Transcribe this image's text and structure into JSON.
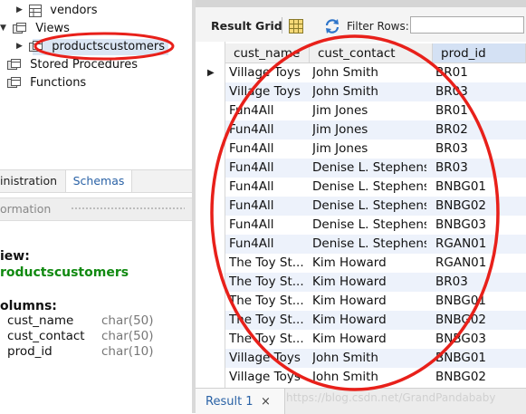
{
  "navigator": {
    "tree": [
      {
        "label": "vendors",
        "icon": "table-icon",
        "expander": "▶"
      },
      {
        "label": "Views",
        "icon": "views-folder-icon",
        "expander": "▼"
      },
      {
        "label": "productscustomers",
        "icon": "view-icon",
        "expander": "▶"
      },
      {
        "label": "Stored Procedures",
        "icon": "folder-icon",
        "expander": ""
      },
      {
        "label": "Functions",
        "icon": "folder-icon",
        "expander": ""
      }
    ],
    "tabs": {
      "administration": "inistration",
      "schemas": "Schemas"
    },
    "info_header": "ormation",
    "info": {
      "kind": "iew:",
      "name": "roductscustomers",
      "columns_label": "olumns:",
      "columns": [
        {
          "name": "cust_name",
          "type": "char(50)"
        },
        {
          "name": "cust_contact",
          "type": "char(50)"
        },
        {
          "name": "prod_id",
          "type": "char(10)"
        }
      ]
    }
  },
  "toolbar": {
    "result_grid_label": "Result Grid",
    "filter_label": "Filter Rows:",
    "filter_value": ""
  },
  "grid": {
    "columns": [
      "cust_name",
      "cust_contact",
      "prod_id"
    ],
    "rows": [
      [
        "Village Toys",
        "John Smith",
        "BR01"
      ],
      [
        "Village Toys",
        "John Smith",
        "BR03"
      ],
      [
        "Fun4All",
        "Jim Jones",
        "BR01"
      ],
      [
        "Fun4All",
        "Jim Jones",
        "BR02"
      ],
      [
        "Fun4All",
        "Jim Jones",
        "BR03"
      ],
      [
        "Fun4All",
        "Denise L. Stephens",
        "BR03"
      ],
      [
        "Fun4All",
        "Denise L. Stephens",
        "BNBG01"
      ],
      [
        "Fun4All",
        "Denise L. Stephens",
        "BNBG02"
      ],
      [
        "Fun4All",
        "Denise L. Stephens",
        "BNBG03"
      ],
      [
        "Fun4All",
        "Denise L. Stephens",
        "RGAN01"
      ],
      [
        "The Toy St...",
        "Kim Howard",
        "RGAN01"
      ],
      [
        "The Toy St...",
        "Kim Howard",
        "BR03"
      ],
      [
        "The Toy St...",
        "Kim Howard",
        "BNBG01"
      ],
      [
        "The Toy St...",
        "Kim Howard",
        "BNBG02"
      ],
      [
        "The Toy St...",
        "Kim Howard",
        "BNBG03"
      ],
      [
        "Village Toys",
        "John Smith",
        "BNBG01"
      ],
      [
        "Village Toys",
        "John Smith",
        "BNBG02"
      ]
    ]
  },
  "result_tabs": [
    {
      "label": "Result 1",
      "close": "×"
    }
  ],
  "watermark": "https://blog.csdn.net/GrandPandababy",
  "colors": {
    "annotation": "#e8201a",
    "view_name": "#118a11",
    "link_blue": "#2a62a6",
    "alt_row": "#edf2fb"
  }
}
